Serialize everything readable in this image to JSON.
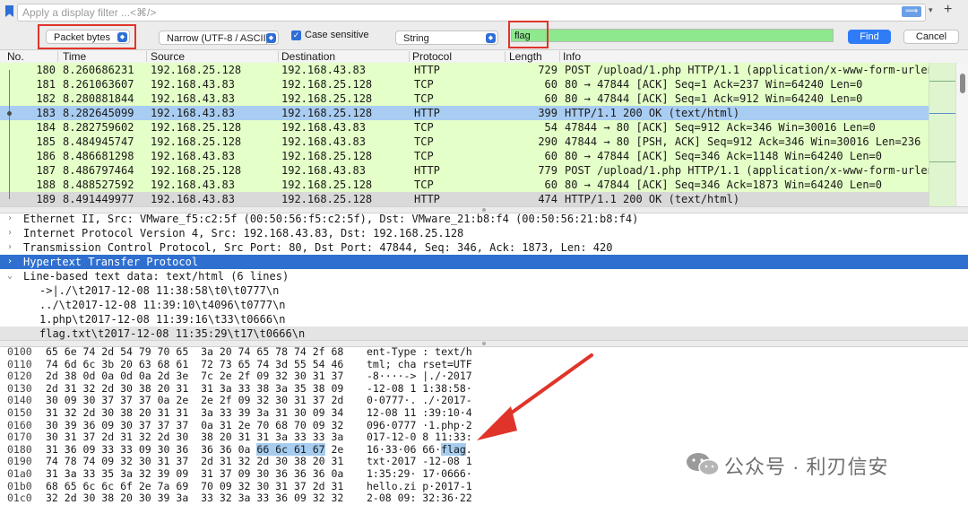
{
  "filter": {
    "placeholder": "Apply a display filter ...<⌘/>",
    "apply_symbol": "⟹",
    "dropdown_symbol": "▾",
    "add_symbol": "+"
  },
  "find": {
    "search_in": "Packet bytes",
    "char_width": "Narrow (UTF-8 / ASCII)",
    "case_sensitive_label": "Case sensitive",
    "case_sensitive_checked": true,
    "search_type": "String",
    "search_text": "flag",
    "find_label": "Find",
    "cancel_label": "Cancel"
  },
  "packet_list": {
    "columns": [
      "No.",
      "Time",
      "Source",
      "Destination",
      "Protocol",
      "Length",
      "Info"
    ],
    "rows": [
      {
        "no": "180",
        "time": "8.260686231",
        "src": "192.168.25.128",
        "dst": "192.168.43.83",
        "proto": "HTTP",
        "len": "729",
        "info": "POST /upload/1.php HTTP/1.1  (application/x-www-form-urlen",
        "bg": "#e4ffc7"
      },
      {
        "no": "181",
        "time": "8.261063607",
        "src": "192.168.43.83",
        "dst": "192.168.25.128",
        "proto": "TCP",
        "len": "60",
        "info": "80 → 47844 [ACK] Seq=1 Ack=237 Win=64240 Len=0",
        "bg": "#e4ffc7"
      },
      {
        "no": "182",
        "time": "8.280881844",
        "src": "192.168.43.83",
        "dst": "192.168.25.128",
        "proto": "TCP",
        "len": "60",
        "info": "80 → 47844 [ACK] Seq=1 Ack=912 Win=64240 Len=0",
        "bg": "#e4ffc7"
      },
      {
        "no": "183",
        "time": "8.282645099",
        "src": "192.168.43.83",
        "dst": "192.168.25.128",
        "proto": "HTTP",
        "len": "399",
        "info": "HTTP/1.1 200 OK  (text/html)",
        "bg": "#a9cdf2"
      },
      {
        "no": "184",
        "time": "8.282759602",
        "src": "192.168.25.128",
        "dst": "192.168.43.83",
        "proto": "TCP",
        "len": "54",
        "info": "47844 → 80 [ACK] Seq=912 Ack=346 Win=30016 Len=0",
        "bg": "#e4ffc7"
      },
      {
        "no": "185",
        "time": "8.484945747",
        "src": "192.168.25.128",
        "dst": "192.168.43.83",
        "proto": "TCP",
        "len": "290",
        "info": "47844 → 80 [PSH, ACK] Seq=912 Ack=346 Win=30016 Len=236 [T",
        "bg": "#e4ffc7"
      },
      {
        "no": "186",
        "time": "8.486681298",
        "src": "192.168.43.83",
        "dst": "192.168.25.128",
        "proto": "TCP",
        "len": "60",
        "info": "80 → 47844 [ACK] Seq=346 Ack=1148 Win=64240 Len=0",
        "bg": "#e4ffc7"
      },
      {
        "no": "187",
        "time": "8.486797464",
        "src": "192.168.25.128",
        "dst": "192.168.43.83",
        "proto": "HTTP",
        "len": "779",
        "info": "POST /upload/1.php HTTP/1.1  (application/x-www-form-urlen",
        "bg": "#e4ffc7"
      },
      {
        "no": "188",
        "time": "8.488527592",
        "src": "192.168.43.83",
        "dst": "192.168.25.128",
        "proto": "TCP",
        "len": "60",
        "info": "80 → 47844 [ACK] Seq=346 Ack=1873 Win=64240 Len=0",
        "bg": "#e4ffc7"
      },
      {
        "no": "189",
        "time": "8.491449977",
        "src": "192.168.43.83",
        "dst": "192.168.25.128",
        "proto": "HTTP",
        "len": "474",
        "info": "HTTP/1.1 200 OK  (text/html)",
        "bg": "#d9d9d9"
      }
    ]
  },
  "details": {
    "rows": [
      {
        "text": "Ethernet II, Src: VMware_f5:c2:5f (00:50:56:f5:c2:5f), Dst: VMware_21:b8:f4 (00:50:56:21:b8:f4)",
        "expander": "›",
        "indent": 0,
        "selected": false
      },
      {
        "text": "Internet Protocol Version 4, Src: 192.168.43.83, Dst: 192.168.25.128",
        "expander": "›",
        "indent": 0,
        "selected": false
      },
      {
        "text": "Transmission Control Protocol, Src Port: 80, Dst Port: 47844, Seq: 346, Ack: 1873, Len: 420",
        "expander": "›",
        "indent": 0,
        "selected": false
      },
      {
        "text": "Hypertext Transfer Protocol",
        "expander": "›",
        "indent": 0,
        "selected": true
      },
      {
        "text": "Line-based text data: text/html (6 lines)",
        "expander": "⌄",
        "indent": 0,
        "selected": false
      },
      {
        "text": "->|./\\t2017-12-08 11:38:58\\t0\\t0777\\n",
        "expander": "",
        "indent": 1,
        "selected": false
      },
      {
        "text": "../\\t2017-12-08 11:39:10\\t4096\\t0777\\n",
        "expander": "",
        "indent": 1,
        "selected": false
      },
      {
        "text": "1.php\\t2017-12-08 11:39:16\\t33\\t0666\\n",
        "expander": "",
        "indent": 1,
        "selected": false
      },
      {
        "text": "flag.txt\\t2017-12-08 11:35:29\\t17\\t0666\\n",
        "expander": "",
        "indent": 1,
        "selected": false,
        "grey": true
      }
    ]
  },
  "bytes": {
    "rows": [
      {
        "off": "0100",
        "hex": "65 6e 74 2d 54 79 70 65  3a 20 74 65 78 74 2f 68",
        "ascii": "ent-Type : text/h"
      },
      {
        "off": "0110",
        "hex": "74 6d 6c 3b 20 63 68 61  72 73 65 74 3d 55 54 46",
        "ascii": "tml; cha rset=UTF"
      },
      {
        "off": "0120",
        "hex": "2d 38 0d 0a 0d 0a 2d 3e  7c 2e 2f 09 32 30 31 37",
        "ascii": "-8····-> |./·2017"
      },
      {
        "off": "0130",
        "hex": "2d 31 32 2d 30 38 20 31  31 3a 33 38 3a 35 38 09",
        "ascii": "-12-08 1 1:38:58·"
      },
      {
        "off": "0140",
        "hex": "30 09 30 37 37 37 0a 2e  2e 2f 09 32 30 31 37 2d",
        "ascii": "0·0777·. ./·2017-"
      },
      {
        "off": "0150",
        "hex": "31 32 2d 30 38 20 31 31  3a 33 39 3a 31 30 09 34",
        "ascii": "12-08 11 :39:10·4"
      },
      {
        "off": "0160",
        "hex": "30 39 36 09 30 37 37 37  0a 31 2e 70 68 70 09 32",
        "ascii": "096·0777 ·1.php·2"
      },
      {
        "off": "0170",
        "hex": "30 31 37 2d 31 32 2d 30  38 20 31 31 3a 33 33 3a",
        "ascii": "017-12-0 8 11:33:"
      },
      {
        "off": "0180",
        "hex": "31 36 09 33 33 09 30 36  36 36 0a ",
        "hex_hl": "66 6c 61 67",
        "hex_tail": " 2e",
        "ascii": "16·33·06 66·",
        "ascii_hl": "flag",
        "ascii_tail": "."
      },
      {
        "off": "0190",
        "hex": "74 78 74 09 32 30 31 37  2d 31 32 2d 30 38 20 31",
        "ascii": "txt·2017 -12-08 1"
      },
      {
        "off": "01a0",
        "hex": "31 3a 33 35 3a 32 39 09  31 37 09 30 36 36 36 0a",
        "ascii": "1:35:29· 17·0666·"
      },
      {
        "off": "01b0",
        "hex": "68 65 6c 6c 6f 2e 7a 69  70 09 32 30 31 37 2d 31",
        "ascii": "hello.zi p·2017-1"
      },
      {
        "off": "01c0",
        "hex": "32 2d 30 38 20 30 39 3a  33 32 3a 33 36 09 32 32",
        "ascii": "2-08 09: 32:36·22"
      }
    ]
  },
  "watermark": {
    "text": "公众号 · 利刃信安"
  },
  "colors": {
    "tcp_http_green": "#e4ffc7",
    "selected_blue": "#a9cdf2",
    "search_green": "#8ee88e",
    "annotation_red": "#e0342a",
    "accent_blue": "#2f7cf6"
  }
}
